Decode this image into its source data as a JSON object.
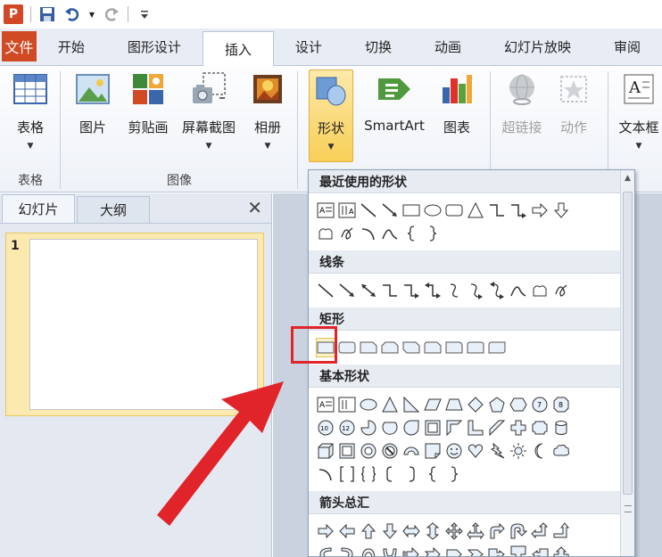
{
  "qat": {
    "app_letter": "P"
  },
  "tabs": {
    "file": "文件",
    "items": [
      "开始",
      "图形设计",
      "插入",
      "设计",
      "切换",
      "动画",
      "幻灯片放映",
      "审阅"
    ]
  },
  "ribbon": {
    "groups": [
      {
        "label": "表格",
        "buttons": [
          {
            "label": "表格",
            "caret": "▼"
          }
        ]
      },
      {
        "label": "图像",
        "buttons": [
          {
            "label": "图片"
          },
          {
            "label": "剪贴画"
          },
          {
            "label": "屏幕截图",
            "caret": "▼"
          },
          {
            "label": "相册",
            "caret": "▼"
          }
        ]
      },
      {
        "label": "",
        "buttons": [
          {
            "label": "形状",
            "caret": "▼"
          },
          {
            "label": "SmartArt"
          },
          {
            "label": "图表"
          }
        ]
      },
      {
        "label": "",
        "buttons": [
          {
            "label": "超链接"
          },
          {
            "label": "动作"
          }
        ]
      },
      {
        "label": "",
        "buttons": [
          {
            "label": "文本框",
            "caret": "▼"
          }
        ]
      }
    ]
  },
  "leftpanel": {
    "tabs": [
      "幻灯片",
      "大纲"
    ],
    "close": "✕",
    "slide_number": "1"
  },
  "dropdown": {
    "sections": [
      "最近使用的形状",
      "线条",
      "矩形",
      "基本形状",
      "箭头总汇"
    ]
  },
  "colors": {
    "accent_file_tab": "#d04a24",
    "highlight": "#f8cf58",
    "annotation": "#e0242a"
  }
}
